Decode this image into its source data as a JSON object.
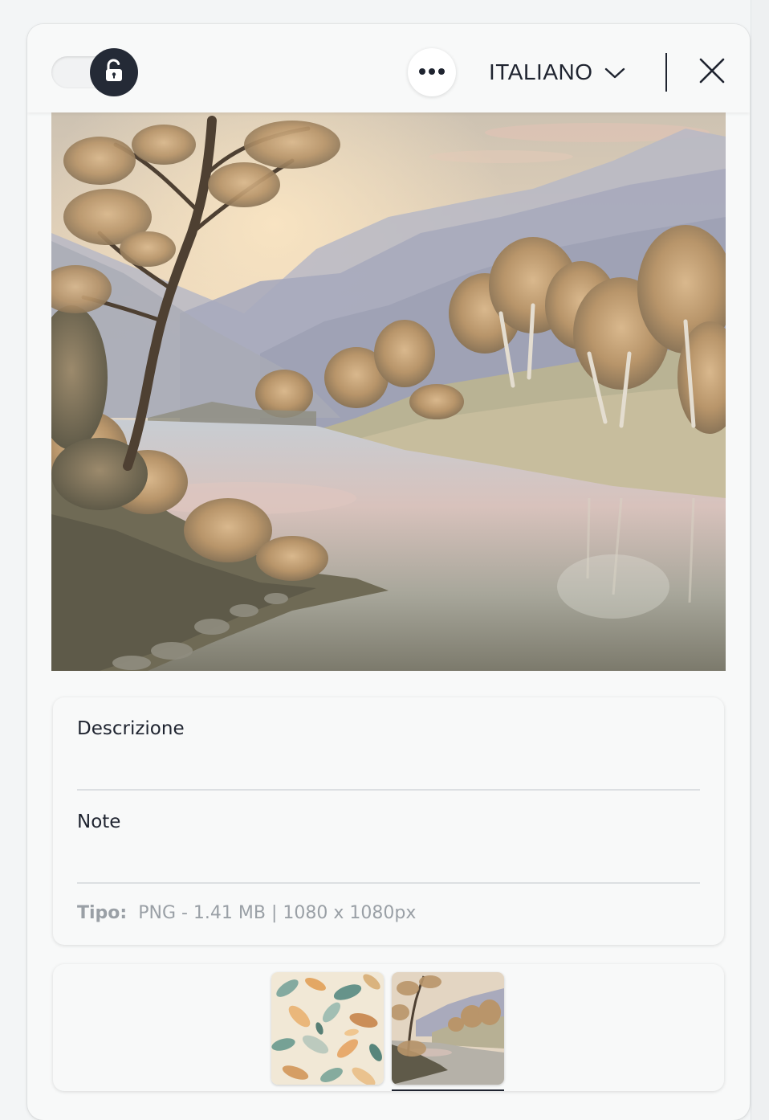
{
  "header": {
    "lock_toggle": {
      "state": "unlocked",
      "icon": "unlock-icon"
    },
    "more_icon": "more-horizontal-icon",
    "language": "ITALIANO",
    "language_icon": "chevron-down-icon",
    "close_icon": "close-icon"
  },
  "preview": {
    "subject": "Landscape painting"
  },
  "details": {
    "description_label": "Descrizione",
    "description_value": "",
    "notes_label": "Note",
    "notes_value": "",
    "type_label": "Tipo:",
    "type_value": "PNG - 1.41 MB | 1080 x 1080px"
  },
  "gallery": {
    "selected_index": 1,
    "items": [
      {
        "subject": "Watercolor leaves pattern"
      },
      {
        "subject": "Landscape painting"
      }
    ]
  },
  "colors": {
    "dark": "#242a36",
    "text": "#1f2430",
    "muted": "#9aa0a6"
  }
}
